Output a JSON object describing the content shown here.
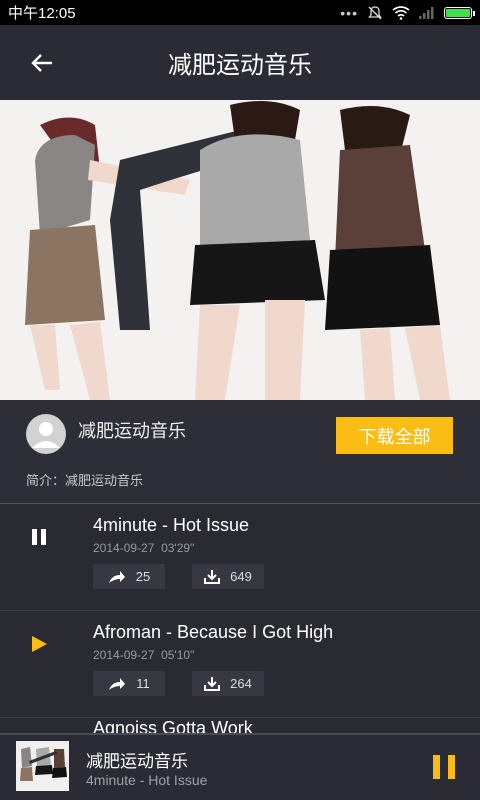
{
  "status_bar": {
    "time": "中午12:05"
  },
  "app_bar": {
    "title": "减肥运动音乐"
  },
  "header": {
    "author": "减肥运动音乐",
    "download_all_label": "下载全部",
    "description": "简介：减肥运动音乐"
  },
  "tracks": [
    {
      "title": "4minute - Hot Issue",
      "date": "2014-09-27",
      "duration": "03'29\"",
      "shares": "25",
      "downloads": "649",
      "state": "playing"
    },
    {
      "title": "Afroman - Because I Got High",
      "date": "2014-09-27",
      "duration": "05'10\"",
      "shares": "11",
      "downloads": "264",
      "state": "paused"
    },
    {
      "title": "Agnoiss Gotta Work",
      "partial": true
    }
  ],
  "player": {
    "title": "减肥运动音乐",
    "subtitle": "4minute - Hot Issue"
  },
  "colors": {
    "accent": "#fbbc13",
    "background": "#2a2a33",
    "battery": "#3ee049"
  }
}
